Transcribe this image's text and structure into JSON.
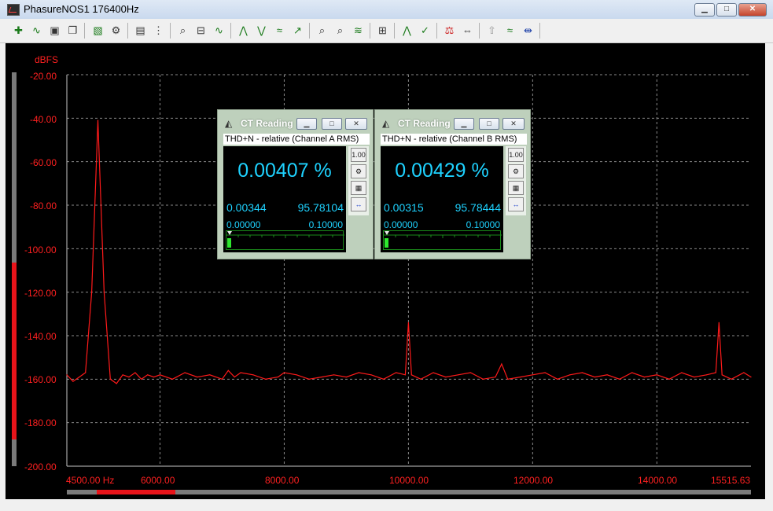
{
  "window": {
    "title": "PhasureNOS1 176400Hz",
    "buttons": {
      "minimize": "▁",
      "maximize": "□",
      "close": "✕"
    }
  },
  "toolbar": {
    "icons": [
      "trace-add-icon",
      "trace-wave-icon",
      "save-icon",
      "copy-icon",
      "chart-icon",
      "settings-icon",
      "table-icon",
      "grid-icon",
      "zoom-icon",
      "zoom-out-icon",
      "wave-icon",
      "peak-up-icon",
      "peak-down-icon",
      "marker-icon",
      "marker-right-icon",
      "find-icon",
      "find-next-icon",
      "curve-icon",
      "fit-icon",
      "trend-icon",
      "check-icon",
      "calibrate-icon",
      "arrows-icon",
      "up-icon",
      "wave-select-icon",
      "cursor-icon"
    ]
  },
  "plot": {
    "y_unit": "dBFS",
    "y_ticks": [
      "-20.00",
      "-40.00",
      "-60.00",
      "-80.00",
      "-100.00",
      "-120.00",
      "-140.00",
      "-160.00",
      "-180.00",
      "-200.00"
    ],
    "x_ticks": [
      "4500.00 Hz",
      "6000.00",
      "8000.00",
      "10000.00",
      "12000.00",
      "14000.00",
      "15515.63"
    ],
    "colors": {
      "background": "#000000",
      "trace": "#ff1a1a",
      "grid": "#8a8a8a",
      "labels": "#ff2020"
    }
  },
  "chart_data": {
    "type": "line",
    "title": "",
    "xlabel": "Hz",
    "ylabel": "dBFS",
    "xlim": [
      4500,
      15515.63
    ],
    "ylim": [
      -200,
      -20
    ],
    "grid": true,
    "series": [
      {
        "x": [
          4500,
          4600,
          4700,
          4800,
          4900,
          5000,
          5100,
          5200,
          5300,
          5400,
          5500,
          5600,
          5700,
          5800,
          5900,
          6000,
          6200,
          6400,
          6600,
          6800,
          7000,
          7100,
          7200,
          7300,
          7500,
          7700,
          7900,
          8000,
          8200,
          8400,
          8600,
          8800,
          9000,
          9200,
          9400,
          9600,
          9800,
          9950,
          10000,
          10050,
          10200,
          10400,
          10600,
          10800,
          11000,
          11200,
          11400,
          11500,
          11600,
          11800,
          12000,
          12200,
          12400,
          12600,
          12800,
          13000,
          13200,
          13400,
          13600,
          13800,
          14000,
          14200,
          14400,
          14600,
          14800,
          14950,
          15000,
          15050,
          15200,
          15400,
          15515.63
        ],
        "values": [
          -158,
          -161,
          -159,
          -157,
          -120,
          -41,
          -120,
          -160,
          -162,
          -158,
          -159,
          -157,
          -160,
          -158,
          -159,
          -158,
          -160,
          -157,
          -159,
          -158,
          -160,
          -156,
          -159,
          -157,
          -158,
          -160,
          -159,
          -157,
          -158,
          -160,
          -159,
          -158,
          -159,
          -157,
          -158,
          -160,
          -157,
          -158,
          -134,
          -158,
          -160,
          -157,
          -159,
          -158,
          -157,
          -160,
          -159,
          -153,
          -160,
          -159,
          -158,
          -157,
          -160,
          -158,
          -157,
          -159,
          -158,
          -160,
          -157,
          -159,
          -158,
          -160,
          -157,
          -159,
          -158,
          -157,
          -134,
          -158,
          -160,
          -157,
          -159
        ]
      }
    ]
  },
  "ct_windows": [
    {
      "title": "CT Reading",
      "subtitle": "THD+N - relative (Channel A RMS)",
      "value": "0.00407 %",
      "min": "0.00344",
      "max": "95.78104",
      "scale_min": "0.00000",
      "scale_max": "0.10000",
      "side_buttons": [
        "1.00",
        "⚙",
        "▦",
        "↔"
      ]
    },
    {
      "title": "CT Reading",
      "subtitle": "THD+N - relative (Channel B RMS)",
      "value": "0.00429 %",
      "min": "0.00315",
      "max": "95.78444",
      "scale_min": "0.00000",
      "scale_max": "0.10000",
      "side_buttons": [
        "1.00",
        "⚙",
        "▦",
        "↔"
      ]
    }
  ]
}
